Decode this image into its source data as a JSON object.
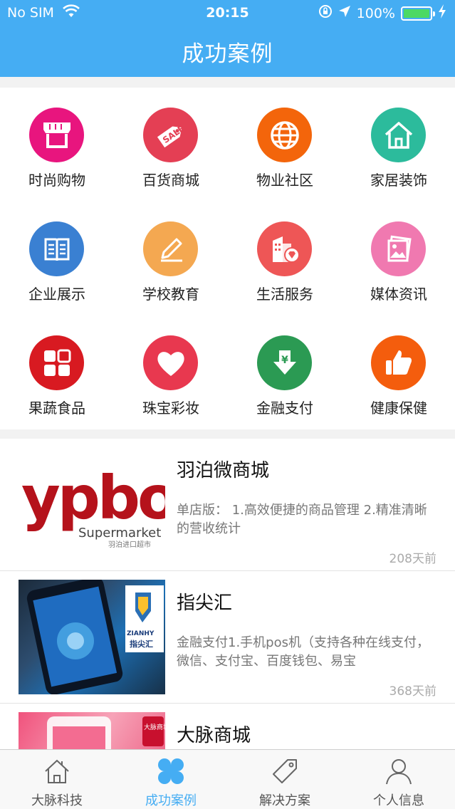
{
  "status_bar": {
    "carrier": "No SIM",
    "time": "20:15",
    "battery": "100%"
  },
  "header": {
    "title": "成功案例"
  },
  "categories": [
    {
      "label": "时尚购物",
      "icon": "shop-icon",
      "color": "#e8157e"
    },
    {
      "label": "百货商城",
      "icon": "sale-tag-icon",
      "color": "#e43f54"
    },
    {
      "label": "物业社区",
      "icon": "globe-icon",
      "color": "#f3650b"
    },
    {
      "label": "家居装饰",
      "icon": "home-icon",
      "color": "#2cbb9c"
    },
    {
      "label": "企业展示",
      "icon": "book-icon",
      "color": "#3a80d2"
    },
    {
      "label": "学校教育",
      "icon": "pencil-icon",
      "color": "#f4a851"
    },
    {
      "label": "生活服务",
      "icon": "building-icon",
      "color": "#ee5656"
    },
    {
      "label": "媒体资讯",
      "icon": "gallery-icon",
      "color": "#f079b0"
    },
    {
      "label": "果蔬食品",
      "icon": "apps-icon",
      "color": "#d81a21"
    },
    {
      "label": "珠宝彩妆",
      "icon": "heart-icon",
      "color": "#e8384f"
    },
    {
      "label": "金融支付",
      "icon": "yen-download-icon",
      "color": "#2b9a53"
    },
    {
      "label": "健康保健",
      "icon": "thumbs-up-icon",
      "color": "#f45d0d"
    }
  ],
  "cases": [
    {
      "name": "羽泊微商城",
      "desc": "单店版：  1.高效便捷的商品管理 2.精准清晰的营收统计",
      "ago": "208天前",
      "logo_text": "ypbo",
      "logo_sub": "Supermarket",
      "logo_sub2": "羽泊进口超市"
    },
    {
      "name": "指尖汇",
      "desc": "金融支付1.手机pos机（支持各种在线支付，微信、支付宝、百度钱包、易宝",
      "ago": "368天前",
      "logo_text": "ZIANHY",
      "logo_sub": "指尖汇"
    },
    {
      "name": "大脉商城",
      "logo_text": "大脉商城"
    }
  ],
  "tabs": [
    {
      "label": "大脉科技",
      "icon": "home-outline-icon",
      "active": false
    },
    {
      "label": "成功案例",
      "icon": "clover-icon",
      "active": true
    },
    {
      "label": "解决方案",
      "icon": "tag-icon",
      "active": false
    },
    {
      "label": "个人信息",
      "icon": "person-icon",
      "active": false
    }
  ]
}
